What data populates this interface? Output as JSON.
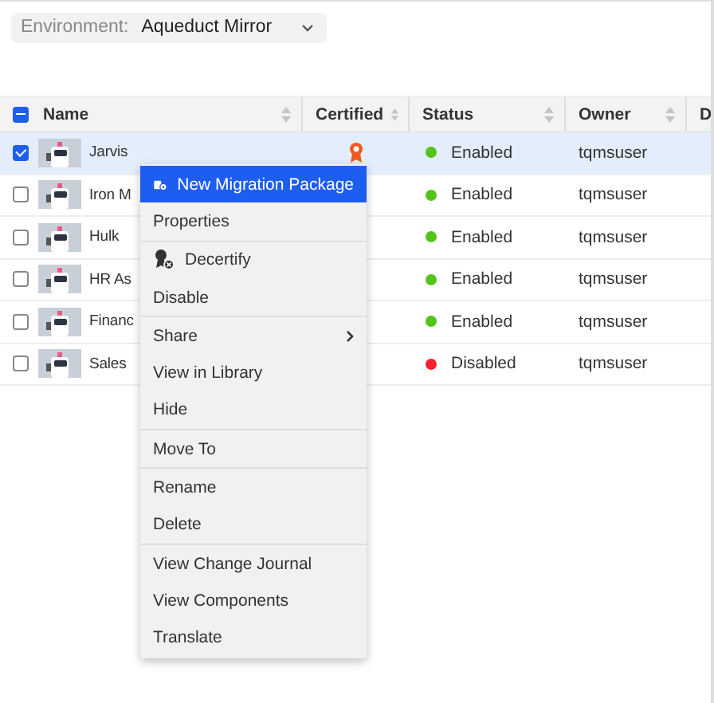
{
  "toolbar": {
    "environment_label": "Environment:",
    "environment_value": "Aqueduct Mirror"
  },
  "table": {
    "select_all": {
      "indeterminate": true
    },
    "columns": [
      "Name",
      "Certified",
      "Status",
      "Owner",
      "D"
    ],
    "rows": [
      {
        "name": "Jarvis",
        "selected": true,
        "certified": true,
        "status": "Enabled",
        "enabled": true,
        "owner": "tqmsuser"
      },
      {
        "name": "Iron M",
        "selected": false,
        "status": "Enabled",
        "enabled": true,
        "owner": "tqmsuser"
      },
      {
        "name": "Hulk",
        "selected": false,
        "status": "Enabled",
        "enabled": true,
        "owner": "tqmsuser"
      },
      {
        "name": "HR As",
        "selected": false,
        "status": "Enabled",
        "enabled": true,
        "owner": "tqmsuser"
      },
      {
        "name": "Financ",
        "selected": false,
        "status": "Enabled",
        "enabled": true,
        "owner": "tqmsuser"
      },
      {
        "name": "Sales",
        "selected": false,
        "status": "Disabled",
        "enabled": false,
        "owner": "tqmsuser"
      }
    ]
  },
  "context_menu": {
    "groups": [
      [
        {
          "label": "New Migration Package",
          "kind": "package",
          "selected": true
        },
        {
          "label": "Properties",
          "kind": "plain",
          "selected": false
        }
      ],
      [
        {
          "label": "Decertify",
          "kind": "decertify",
          "selected": false
        },
        {
          "label": "Disable",
          "kind": "plain",
          "selected": false
        }
      ],
      [
        {
          "label": "Share",
          "kind": "submenu",
          "selected": false
        },
        {
          "label": "View in Library",
          "kind": "plain",
          "selected": false
        },
        {
          "label": "Hide",
          "kind": "plain",
          "selected": false
        }
      ],
      [
        {
          "label": "Move To",
          "kind": "plain",
          "selected": false
        }
      ],
      [
        {
          "label": "Rename",
          "kind": "plain",
          "selected": false
        },
        {
          "label": "Delete",
          "kind": "plain",
          "selected": false
        }
      ],
      [
        {
          "label": "View Change Journal",
          "kind": "plain",
          "selected": false
        },
        {
          "label": "View Components",
          "kind": "plain",
          "selected": false
        },
        {
          "label": "Translate",
          "kind": "plain",
          "selected": false
        }
      ]
    ]
  }
}
